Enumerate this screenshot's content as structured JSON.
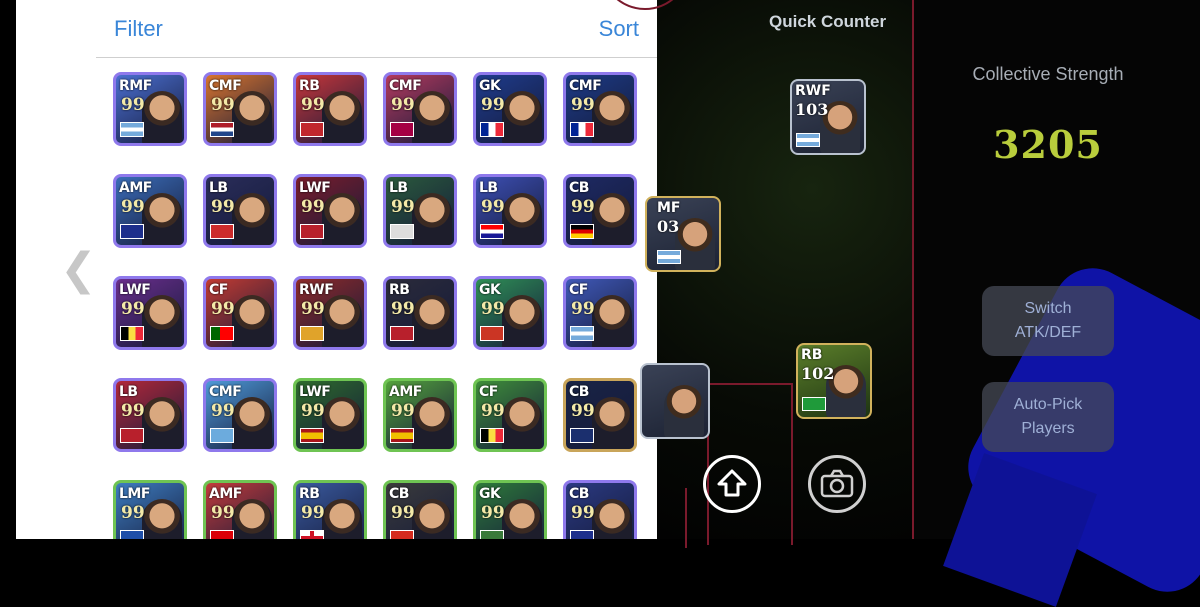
{
  "panel": {
    "filter_label": "Filter",
    "sort_label": "Sort",
    "cards": [
      {
        "pos": "RMF",
        "rating": "99",
        "flag": "argentina",
        "border": "#8f79ec",
        "bg": "#4b6fd0"
      },
      {
        "pos": "CMF",
        "rating": "99",
        "flag": "netherlands",
        "border": "#8f79ec",
        "bg": "#d8742e"
      },
      {
        "pos": "RB",
        "rating": "99",
        "flag": "morocco",
        "border": "#8f79ec",
        "bg": "#c7363a"
      },
      {
        "pos": "CMF",
        "rating": "99",
        "flag": "barcelona",
        "border": "#8f79ec",
        "bg": "#b33a5e"
      },
      {
        "pos": "GK",
        "rating": "99",
        "flag": "france",
        "border": "#8f79ec",
        "bg": "#1f3c8d"
      },
      {
        "pos": "CMF",
        "rating": "99",
        "flag": "france",
        "border": "#8f79ec",
        "bg": "#1d3b86"
      },
      {
        "pos": "AMF",
        "rating": "99",
        "flag": "inter",
        "border": "#8f79ec",
        "bg": "#3b6db8"
      },
      {
        "pos": "LB",
        "rating": "99",
        "flag": "club",
        "border": "#8f79ec",
        "bg": "#2a2d5a"
      },
      {
        "pos": "LWF",
        "rating": "99",
        "flag": "milan",
        "border": "#8f79ec",
        "bg": "#7a1d2c"
      },
      {
        "pos": "LB",
        "rating": "99",
        "flag": "club2",
        "border": "#8f79ec",
        "bg": "#2b5a3c"
      },
      {
        "pos": "LB",
        "rating": "99",
        "flag": "croatia",
        "border": "#8f79ec",
        "bg": "#3d4fb3"
      },
      {
        "pos": "CB",
        "rating": "99",
        "flag": "germany",
        "border": "#8f79ec",
        "bg": "#1e2a64"
      },
      {
        "pos": "LWF",
        "rating": "99",
        "flag": "belgium",
        "border": "#8f79ec",
        "bg": "#6a2e8c"
      },
      {
        "pos": "CF",
        "rating": "99",
        "flag": "portugal",
        "border": "#8f79ec",
        "bg": "#c33b32"
      },
      {
        "pos": "RWF",
        "rating": "99",
        "flag": "spain-club",
        "border": "#8f79ec",
        "bg": "#8e2a2a"
      },
      {
        "pos": "RB",
        "rating": "99",
        "flag": "milan",
        "border": "#8f79ec",
        "bg": "#2b2b3a"
      },
      {
        "pos": "GK",
        "rating": "99",
        "flag": "atletico",
        "border": "#8f79ec",
        "bg": "#2f8f56"
      },
      {
        "pos": "CF",
        "rating": "99",
        "flag": "argentina",
        "border": "#8f79ec",
        "bg": "#4059b8"
      },
      {
        "pos": "LB",
        "rating": "99",
        "flag": "milan",
        "border": "#8f79ec",
        "bg": "#b2283a"
      },
      {
        "pos": "CMF",
        "rating": "99",
        "flag": "city",
        "border": "#8f79ec",
        "bg": "#4f9ad8"
      },
      {
        "pos": "LWF",
        "rating": "99",
        "flag": "spain",
        "border": "#6fc453",
        "bg": "#2e6b2c"
      },
      {
        "pos": "AMF",
        "rating": "99",
        "flag": "spain",
        "border": "#6fc453",
        "bg": "#54a23c"
      },
      {
        "pos": "CF",
        "rating": "99",
        "flag": "belgium",
        "border": "#6fc453",
        "bg": "#3f8e3a"
      },
      {
        "pos": "CB",
        "rating": "99",
        "flag": "psg",
        "border": "#c9a55a",
        "bg": "#1a2446"
      },
      {
        "pos": "LMF",
        "rating": "99",
        "flag": "como",
        "border": "#6fc453",
        "bg": "#3e7dc0"
      },
      {
        "pos": "AMF",
        "rating": "99",
        "flag": "arsenal",
        "border": "#6fc453",
        "bg": "#c23b3b"
      },
      {
        "pos": "RB",
        "rating": "99",
        "flag": "england",
        "border": "#6fc453",
        "bg": "#3a5a9e"
      },
      {
        "pos": "CB",
        "rating": "99",
        "flag": "switzerland",
        "border": "#6fc453",
        "bg": "#3b3b3b"
      },
      {
        "pos": "GK",
        "rating": "99",
        "flag": "club3",
        "border": "#6fc453",
        "bg": "#2e7a3a"
      },
      {
        "pos": "CB",
        "rating": "99",
        "flag": "inter",
        "border": "#8f79ec",
        "bg": "#2b3a82"
      }
    ]
  },
  "field": {
    "title": "Quick Counter",
    "cards": [
      {
        "pos": "RWF",
        "rating": "103",
        "flag": "argentina"
      },
      {
        "pos": "MF",
        "rating": "03",
        "flag": "argentina"
      },
      {
        "pos": "RB",
        "rating": "102",
        "flag": "brazil"
      },
      {
        "pos": "",
        "rating": "",
        "flag": ""
      }
    ]
  },
  "side": {
    "collective_label": "Collective Strength",
    "strength_value": "3205",
    "switch_label": "Switch ATK/DEF",
    "autopick_label": "Auto-Pick Players"
  },
  "colors": {
    "accent_blue": "#3a86d8",
    "strength_yellow": "#b9cd3c",
    "pitch_line": "#7a1a2c",
    "side_blue": "#0f13a6"
  }
}
